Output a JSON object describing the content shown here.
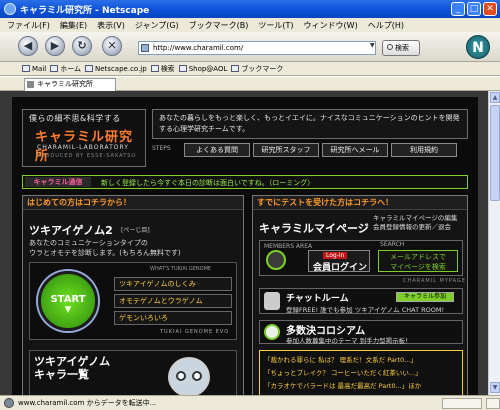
{
  "window": {
    "title": "キャラミル研究所 - Netscape"
  },
  "menu": [
    "ファイル(F)",
    "編集(E)",
    "表示(V)",
    "ジャンプ(G)",
    "ブックマーク(B)",
    "ツール(T)",
    "ウィンドウ(W)",
    "ヘルプ(H)"
  ],
  "nav": {
    "url": "http://www.charamil.com/",
    "search_label": "検索",
    "throbber": "N"
  },
  "personal_bar": [
    "Mail",
    "ホーム",
    "Netscape.co.jp",
    "検索",
    "Shop@AOL",
    "ブックマーク"
  ],
  "tab": {
    "label": "キャラミル研究所"
  },
  "site": {
    "catch": "僕らの細不思&科学する",
    "logo": "キャラミル研究所",
    "logo_en": "CHARAMIL-LABORATORY",
    "logo_en2": "PRODUCED BY ESSE-SAKATSU",
    "intro": "あなたの暮らしをもっと楽しく、もっとイエイに。ナイスなコミュニケーションのヒントを開発する心理学研究チームです。",
    "steps_label": "STEPS",
    "head_links": [
      "よくある質問",
      "研究所スタッフ",
      "研究所へメール",
      "利用規約"
    ],
    "ticker_badge": "キャラミル通信",
    "ticker_text": "新しく登録したら今すぐ本日の診断は面白いですね。（ローミング）",
    "left": {
      "heading": "はじめての方はコチラから！",
      "tg_title": "ツキアイゲノム2",
      "tg_page": "[ぺーじ目]",
      "tg_desc1": "あなたのコミュニケーションタイプの",
      "tg_desc2": "ウラとオモテを診断します。(もちろん無料です)",
      "whats": "WHAT'S TUKIAI GENOME",
      "start": "START",
      "start_arrow": "▼",
      "links": [
        "ツキアイゲノムのしくみ",
        "オモテゲノムとウラゲノム",
        "ゲモンいろいろ"
      ],
      "brand": "TUKIAI GENOME EVO",
      "ichiran_title1": "ツキアイゲノム",
      "ichiran_title2": "キャラ一覧"
    },
    "right": {
      "heading": "すでにテストを受けた方はコチラへ！",
      "mp_title": "キャラミルマイページ",
      "mp_desc1": "キャラミルマイページの編集",
      "mp_desc2": "会員登録情報の更新／退会",
      "members": "MEMBERS AREA",
      "search": "SEARCH",
      "login_tag": "Log-in",
      "login": "会員ログイン",
      "mailsearch1": "メールアドレスで",
      "mailsearch2": "マイページを検索",
      "brand": "CHARAMIL MYPAGE",
      "chat_title": "チャットルーム",
      "chat_btn": "キャラミル参加",
      "chat_sub": "登録FREE! 誰でも参加 ツキアイゲノム CHAT ROOM!",
      "tasu_title": "多数決コロシアム",
      "tasu_sub": "参加人数募集中のテーマ 到手力型掲示板！",
      "topics": [
        "「裁かれる罪らに 私は？ 理系だ！文系だ Part0...」",
        "「ちょっとブレイク？ コーヒーいただく紅茶いい...」",
        "「カラオケでバラードは 最高だ最高だ Part0...」ほか"
      ]
    }
  },
  "status": {
    "text": "www.charamil.com からデータを転送中..."
  },
  "colors": {
    "accent": "#ff9a2e",
    "green": "#7fcf2a",
    "background": "#0b0b0b",
    "titlebar": "#0a4fd4"
  }
}
